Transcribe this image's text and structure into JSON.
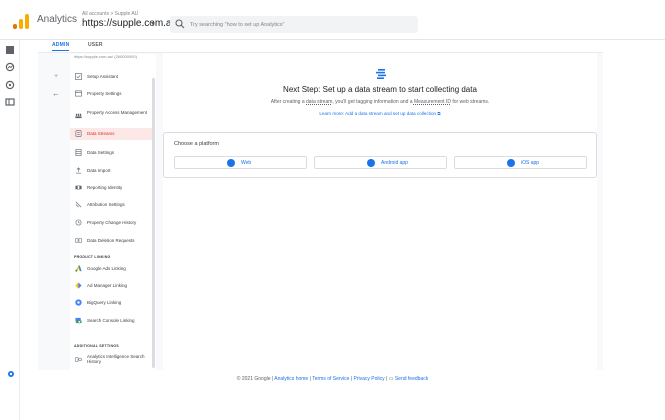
{
  "header": {
    "app_title": "Analytics",
    "account_path": "All accounts > Supple AU",
    "account_name": "https://supple.com.au/",
    "search_placeholder": "Try searching \"how to set up Analytics\""
  },
  "tabs": {
    "admin": "ADMIN",
    "user": "USER"
  },
  "property_nav": {
    "subtitle": "https://supple.com.au/ (260000000)",
    "items": [
      {
        "label": "Setup Assistant",
        "icon": "checklist-icon"
      },
      {
        "label": "Property Settings",
        "icon": "property-icon"
      },
      {
        "label": "Property Access Management",
        "icon": "people-icon"
      },
      {
        "label": "Data Streams",
        "icon": "streams-icon"
      },
      {
        "label": "Data Settings",
        "icon": "database-icon"
      },
      {
        "label": "Data Import",
        "icon": "upload-icon"
      },
      {
        "label": "Reporting Identity",
        "icon": "identity-icon"
      },
      {
        "label": "Attribution Settings",
        "icon": "attribution-icon"
      },
      {
        "label": "Property Change History",
        "icon": "history-icon"
      },
      {
        "label": "Data Deletion Requests",
        "icon": "dd-icon"
      }
    ],
    "product_linking_heading": "PRODUCT LINKING",
    "product_linking": [
      {
        "label": "Google Ads Linking"
      },
      {
        "label": "Ad Manager Linking"
      },
      {
        "label": "BigQuery Linking"
      },
      {
        "label": "Search Console Linking"
      }
    ],
    "additional_heading": "ADDITIONAL SETTINGS",
    "additional": [
      {
        "label": "Analytics Intelligence Search History"
      }
    ]
  },
  "main": {
    "headline": "Next Step: Set up a data stream to start collecting data",
    "subline_a": "After creating a ",
    "subline_stream": "data stream",
    "subline_b": ", you'll get tagging information and a ",
    "subline_mid": "Measurement ID",
    "subline_c": " for web streams.",
    "learn_more": "Learn more: Add a data stream and set up data collection",
    "choose_label": "Choose a platform",
    "platforms": [
      {
        "label": "Web"
      },
      {
        "label": "Android app"
      },
      {
        "label": "iOS app"
      }
    ]
  },
  "footer": {
    "copyright": "© 2021 Google | ",
    "analytics_home": "Analytics home",
    "sep1": " | ",
    "terms": "Terms of Service",
    "sep2": " | ",
    "privacy": "Privacy Policy",
    "sep3": " | ",
    "feedback": "Send feedback"
  },
  "colors": {
    "accent": "#1a73e8",
    "active_nav_bg": "#fce8e6",
    "active_nav_text": "#d93025"
  }
}
